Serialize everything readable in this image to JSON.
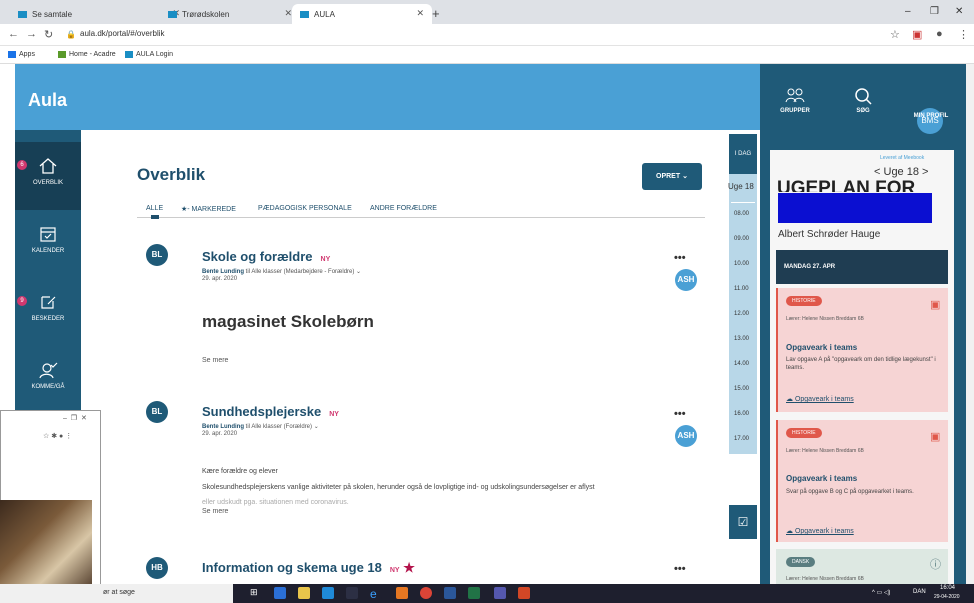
{
  "browser": {
    "tabs": [
      {
        "label": "Se samtale"
      },
      {
        "label": "Trørødskolen"
      },
      {
        "label": "AULA"
      }
    ],
    "url": "aula.dk/portal/#/overblik",
    "bookmarks": [
      "Apps",
      "Home - Acadre",
      "AULA Login"
    ]
  },
  "header": {
    "logo": "Aula",
    "groups_label": "GRUPPER",
    "search_label": "SØG",
    "profile_initials": "BMS",
    "profile_label": "MIN PROFIL"
  },
  "sidebar": {
    "items": [
      {
        "label": "OVERBLIK",
        "badge": "6"
      },
      {
        "label": "KALENDER"
      },
      {
        "label": "BESKEDER",
        "badge": "9"
      },
      {
        "label": "KOMME/GÅ"
      }
    ]
  },
  "main": {
    "title": "Overblik",
    "opret_label": "OPRET",
    "filters": [
      "ALLE",
      "- MARKEREDE",
      "PÆDAGOGISK PERSONALE",
      "ANDRE FORÆLDRE"
    ],
    "posts": [
      {
        "avatar": "BL",
        "title": "Skole og forældre",
        "ny": "NY",
        "author": "Bente Lunding",
        "to": "til Alle klasser (Medarbejdere - Forældre)",
        "date": "29. apr. 2020",
        "assignee": "ASH",
        "big_text": "magasinet Skolebørn",
        "more": "Se mere"
      },
      {
        "avatar": "BL",
        "title": "Sundhedsplejerske",
        "ny": "NY",
        "author": "Bente Lunding",
        "to": "til Alle klasser (Forældre)",
        "date": "29. apr. 2020",
        "assignee": "ASH",
        "body1": "Kære forældre og elever",
        "body2": "Skolesundhedsplejerskens vanlige aktiviteter på skolen, herunder også de lovpligtige ind- og udskolingsundersøgelser er aflyst",
        "body3": "eller udskudt pga. situationen med coronavirus.",
        "more": "Se mere"
      },
      {
        "avatar": "HB",
        "title": "Information og skema uge 18",
        "ny": "NY"
      }
    ]
  },
  "timeline": {
    "today": "I DAG",
    "week": "Uge 18",
    "hours": [
      "08.00",
      "09.00",
      "10.00",
      "11.00",
      "12.00",
      "13.00",
      "14.00",
      "15.00",
      "16.00",
      "17.00"
    ]
  },
  "ugeplan": {
    "provider": "Leveret af Meebook",
    "week_label": "Uge 18",
    "heading": "UGEPLAN FOR",
    "student": "Albert Schrøder Hauge",
    "day": "MANDAG 27. APR",
    "cards": [
      {
        "tag": "HISTORIE",
        "teacher": "Lærer: Helene Nissen Breddam 6B",
        "title": "Opgaveark i teams",
        "text": "Lav opgave A på \"opgaveark om den tidlige lægekunst\" i teams.",
        "link": "Opgaveark i teams"
      },
      {
        "tag": "HISTORIE",
        "teacher": "Lærer: Helene Nissen Breddam 6B",
        "title": "Opgaveark i teams",
        "text": "Svar på opgave B og C på opgavearket i teams.",
        "link": "Opgaveark i teams"
      },
      {
        "tag": "DANSK",
        "teacher": "Lærer: Helene Nissen Breddam 6B"
      }
    ]
  },
  "taskbar": {
    "search": "ør at søge",
    "lang": "DAN",
    "time": "16:04",
    "date": "29-04-2020"
  }
}
